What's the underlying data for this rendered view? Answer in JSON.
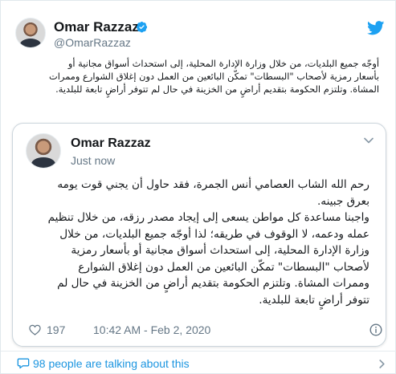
{
  "header": {
    "name": "Omar Razzaz",
    "handle": "@OmarRazzaz"
  },
  "intro_lines": [
    "أوجّه جميع البلديات، من خلال وزارة الإدارة المحلية، إلى استحداث أسواق مجانية أو",
    "بأسعار رمزية لأصحاب \"البسطات\" تمكّن البائعين من العمل دون إغلاق الشوارع وممرات",
    "المشاة. وتلتزم الحكومة بتقديم أراضٍ من الخزينة في حال لم تتوفر أراضٍ تابعة للبلدية."
  ],
  "card": {
    "name": "Omar Razzaz",
    "time": "Just now",
    "lines": [
      "رحم الله الشاب العصامي أنس الجمرة، فقد حاول أن يجني قوت يومه",
      "بعرق جبينه.",
      "واجبنا مساعدة كل مواطن يسعى إلى إيجاد مصدر رزقه، من خلال تنظيم",
      "عمله ودعمه، لا الوقوف في طريقه؛ لذا أوجّه جميع البلديات، من خلال",
      "وزارة الإدارة المحلية، إلى استحداث أسواق مجانية أو بأسعار رمزية",
      "لأصحاب \"البسطات\" تمكّن البائعين من العمل دون إغلاق الشوارع",
      "وممرات المشاة. وتلتزم الحكومة بتقديم أراضٍ من الخزينة في حال لم",
      "تتوفر أراضٍ تابعة للبلدية."
    ],
    "likes": "197",
    "timestamp": "10:42 AM - Feb 2, 2020"
  },
  "footer": {
    "talking": "98 people are talking about this"
  },
  "colors": {
    "twitter_blue": "#1da1f2",
    "link_blue": "#1b95e0",
    "muted": "#657786"
  }
}
